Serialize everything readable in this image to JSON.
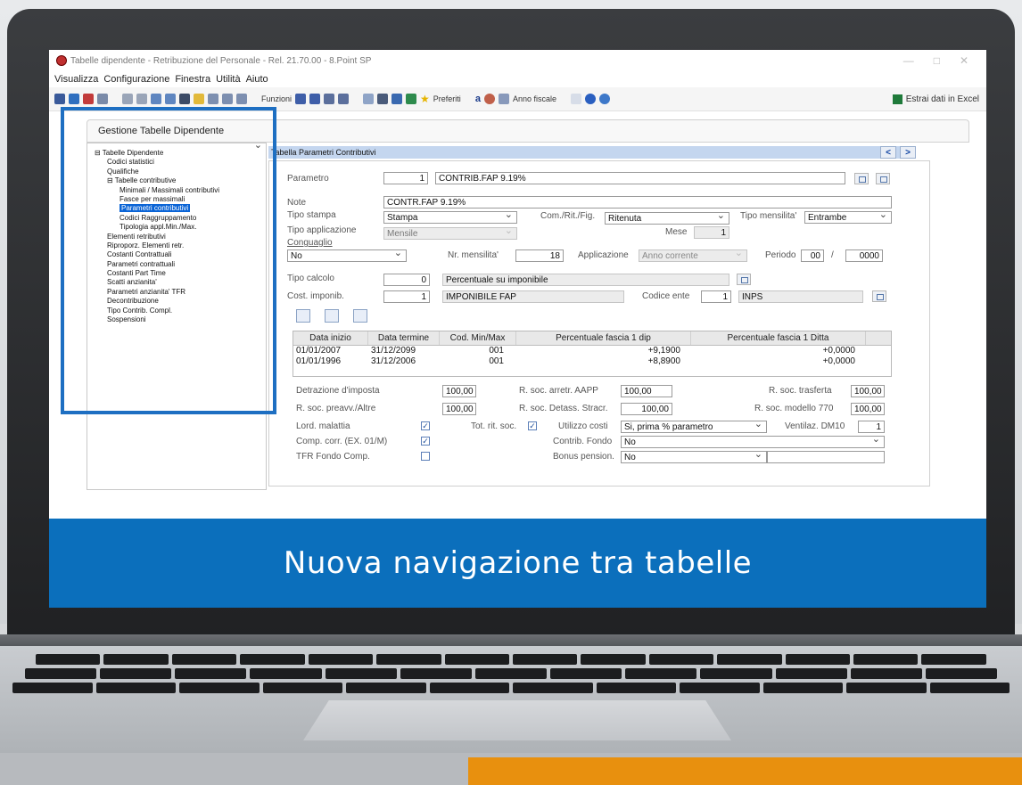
{
  "window": {
    "title": "Tabelle dipendente - Retribuzione del Personale - Rel. 21.70.00 - 8.Point SP",
    "controls": [
      "—",
      "□",
      "✕"
    ]
  },
  "menu": [
    "Visualizza",
    "Configurazione",
    "Finestra",
    "Utilità",
    "Aiuto"
  ],
  "toolbar": {
    "funzioni_label": "Funzioni",
    "preferiti_label": "Preferiti",
    "anno_fiscale_label": "Anno fiscale",
    "excel_label": "Estrai dati in Excel"
  },
  "panel_title": "Gestione Tabelle Dipendente",
  "tree": [
    {
      "label": "Tabelle Dipendente",
      "prefix": "⊟ ",
      "indent": 0
    },
    {
      "label": "Codici statistici",
      "prefix": "",
      "indent": 1
    },
    {
      "label": "Qualifiche",
      "prefix": "",
      "indent": 1
    },
    {
      "label": "Tabelle contributive",
      "prefix": "⊟ ",
      "indent": 1
    },
    {
      "label": "Minimali / Massimali contributivi",
      "prefix": "",
      "indent": 2
    },
    {
      "label": "Fasce per massimali",
      "prefix": "",
      "indent": 2
    },
    {
      "label": "Parametri contributivi",
      "prefix": "",
      "indent": 2,
      "selected": true
    },
    {
      "label": "Codici Raggruppamento",
      "prefix": "",
      "indent": 2
    },
    {
      "label": "Tipologia appl.Min./Max.",
      "prefix": "",
      "indent": 2
    },
    {
      "label": "Elementi retributivi",
      "prefix": "",
      "indent": 1
    },
    {
      "label": "Riproporz. Elementi retr.",
      "prefix": "",
      "indent": 1
    },
    {
      "label": "Costanti Contrattuali",
      "prefix": "",
      "indent": 1
    },
    {
      "label": "Parametri contrattuali",
      "prefix": "",
      "indent": 1
    },
    {
      "label": "Costanti Part Time",
      "prefix": "",
      "indent": 1
    },
    {
      "label": "Scatti anzianita'",
      "prefix": "",
      "indent": 1
    },
    {
      "label": "Parametri anzianita' TFR",
      "prefix": "",
      "indent": 1
    },
    {
      "label": "Decontribuzione",
      "prefix": "",
      "indent": 1
    },
    {
      "label": "Tipo Contrib. Compl.",
      "prefix": "",
      "indent": 1
    },
    {
      "label": "Sospensioni",
      "prefix": "",
      "indent": 1
    }
  ],
  "section_title": "Tabella Parametri Contributivi",
  "nav": {
    "prev": "<",
    "next": ">"
  },
  "form": {
    "parametro": {
      "label": "Parametro",
      "code": "1",
      "desc": "CONTRIB.FAP 9.19%"
    },
    "note": {
      "label": "Note",
      "value": "CONTR.FAP 9.19%"
    },
    "tipo_stampa": {
      "label": "Tipo stampa",
      "value": "Stampa"
    },
    "com_rit_fig": {
      "label": "Com./Rit./Fig.",
      "value": "Ritenuta"
    },
    "tipo_mensilita": {
      "label": "Tipo mensilita'",
      "value": "Entrambe"
    },
    "tipo_applicazione": {
      "label": "Tipo applicazione",
      "value": "Mensile"
    },
    "mese": {
      "label": "Mese",
      "value": "1"
    },
    "conguaglio": {
      "label": "Conguaglio",
      "value": "No"
    },
    "nr_mensilita": {
      "label": "Nr. mensilita'",
      "value": "18"
    },
    "applicazione": {
      "label": "Applicazione",
      "value": "Anno corrente"
    },
    "periodo": {
      "label": "Periodo",
      "v1": "00",
      "sep": "/",
      "v2": "0000"
    },
    "tipo_calcolo": {
      "label": "Tipo calcolo",
      "code": "0",
      "desc": "Percentuale su imponibile"
    },
    "cost_imponib": {
      "label": "Cost. imponib.",
      "code": "1",
      "desc": "IMPONIBILE FAP"
    },
    "codice_ente": {
      "label": "Codice ente",
      "code": "1",
      "desc": "INPS"
    }
  },
  "grid": {
    "headers": [
      "Data inizio",
      "Data termine",
      "Cod. Min/Max",
      "Percentuale fascia 1 dip",
      "Percentuale fascia 1 Ditta"
    ],
    "rows": [
      [
        "01/01/2007",
        "31/12/2099",
        "001",
        "+9,1900",
        "+0,0000"
      ],
      [
        "01/01/1996",
        "31/12/2006",
        "001",
        "+8,8900",
        "+0,0000"
      ]
    ]
  },
  "bottom": {
    "detrazione": {
      "label": "Detrazione d'imposta",
      "value": "100,00"
    },
    "rsoc_arretr": {
      "label": "R. soc. arretr. AAPP",
      "value": "100,00"
    },
    "rsoc_trasferta": {
      "label": "R. soc. trasferta",
      "value": "100,00"
    },
    "rsoc_preavv": {
      "label": "R. soc. preavv./Altre",
      "value": "100,00"
    },
    "rsoc_detass": {
      "label": "R. soc. Detass. Stracr.",
      "value": "100,00"
    },
    "rsoc_770": {
      "label": "R. soc. modello 770",
      "value": "100,00"
    },
    "lord_malattia": {
      "label": "Lord. malattia",
      "checked": true
    },
    "tot_rit_soc": {
      "label": "Tot. rit. soc.",
      "checked": true
    },
    "utilizzo_costi": {
      "label": "Utilizzo costi",
      "value": "Si, prima % parametro"
    },
    "ventilaz": {
      "label": "Ventilaz. DM10",
      "value": "1"
    },
    "comp_corr": {
      "label": "Comp. corr. (EX. 01/M)",
      "checked": true
    },
    "contrib_fondo": {
      "label": "Contrib. Fondo",
      "value": "No"
    },
    "tfr_fondo": {
      "label": "TFR Fondo Comp.",
      "checked": false
    },
    "bonus_pension": {
      "label": "Bonus pension.",
      "value": "No"
    }
  },
  "banner": "Nuova navigazione tra tabelle",
  "colors": {
    "highlight_frame": "#1e6fc2",
    "banner": "#0b6fbc",
    "accent_orange": "#e8900e",
    "selection": "#0a64d6"
  }
}
